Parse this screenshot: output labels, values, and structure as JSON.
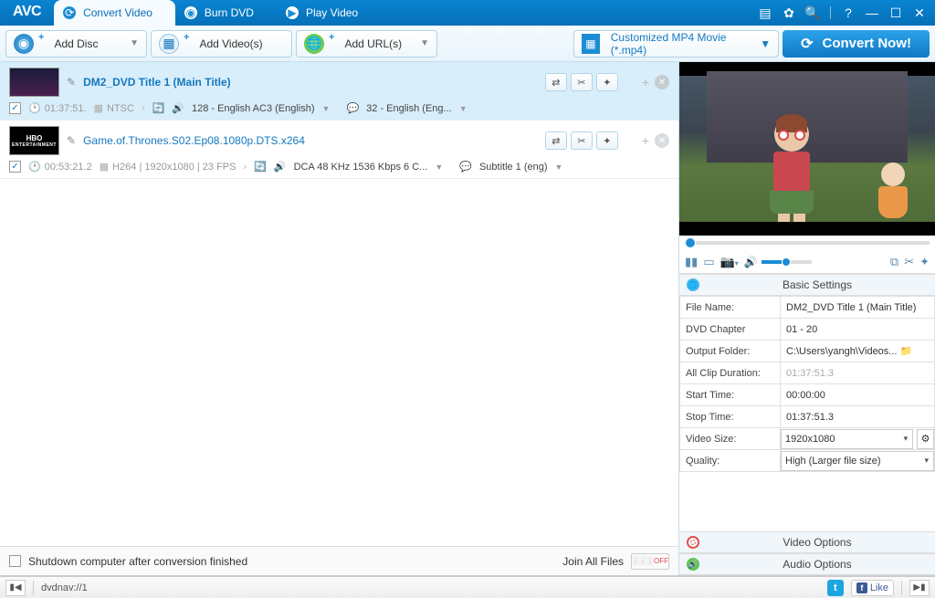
{
  "app_logo": "AVC",
  "tabs": {
    "convert": "Convert Video",
    "burn": "Burn DVD",
    "play": "Play Video"
  },
  "toolbar": {
    "add_disc": "Add Disc",
    "add_videos": "Add Video(s)",
    "add_urls": "Add URL(s)",
    "profile": "Customized MP4 Movie (*.mp4)",
    "convert_now": "Convert Now!"
  },
  "files": [
    {
      "title": "DM2_DVD Title 1 (Main Title)",
      "duration": "01:37:51.",
      "codec": "NTSC",
      "audio": "128 - English AC3 (English)",
      "subtitle": "32 - English (Eng..."
    },
    {
      "title": "Game.of.Thrones.S02.Ep08.1080p.DTS.x264",
      "duration": "00:53:21.2",
      "codec": "H264 | 1920x1080 | 23 FPS",
      "audio": "DCA 48 KHz 1536 Kbps 6 C...",
      "subtitle": "Subtitle 1 (eng)"
    }
  ],
  "left_footer": {
    "shutdown": "Shutdown computer after conversion finished",
    "join": "Join All Files",
    "toggle_off": "OFF"
  },
  "settings_header": "Basic Settings",
  "video_options": "Video Options",
  "audio_options": "Audio Options",
  "settings": {
    "file_name_label": "File Name:",
    "file_name": "DM2_DVD Title 1 (Main Title)",
    "dvd_chapter_label": "DVD Chapter",
    "dvd_chapter": "01 - 20",
    "output_folder_label": "Output Folder:",
    "output_folder": "C:\\Users\\yangh\\Videos...",
    "all_clip_label": "All Clip Duration:",
    "all_clip": "01:37:51.3",
    "start_time_label": "Start Time:",
    "start_time": "00:00:00",
    "stop_time_label": "Stop Time:",
    "stop_time": "01:37:51.3",
    "video_size_label": "Video Size:",
    "video_size": "1920x1080",
    "quality_label": "Quality:",
    "quality": "High (Larger file size)"
  },
  "status": {
    "path": "dvdnav://1",
    "like": "Like"
  },
  "thumb_hbo": "HBO",
  "thumb_hbo_sub": "ENTERTAINMENT"
}
